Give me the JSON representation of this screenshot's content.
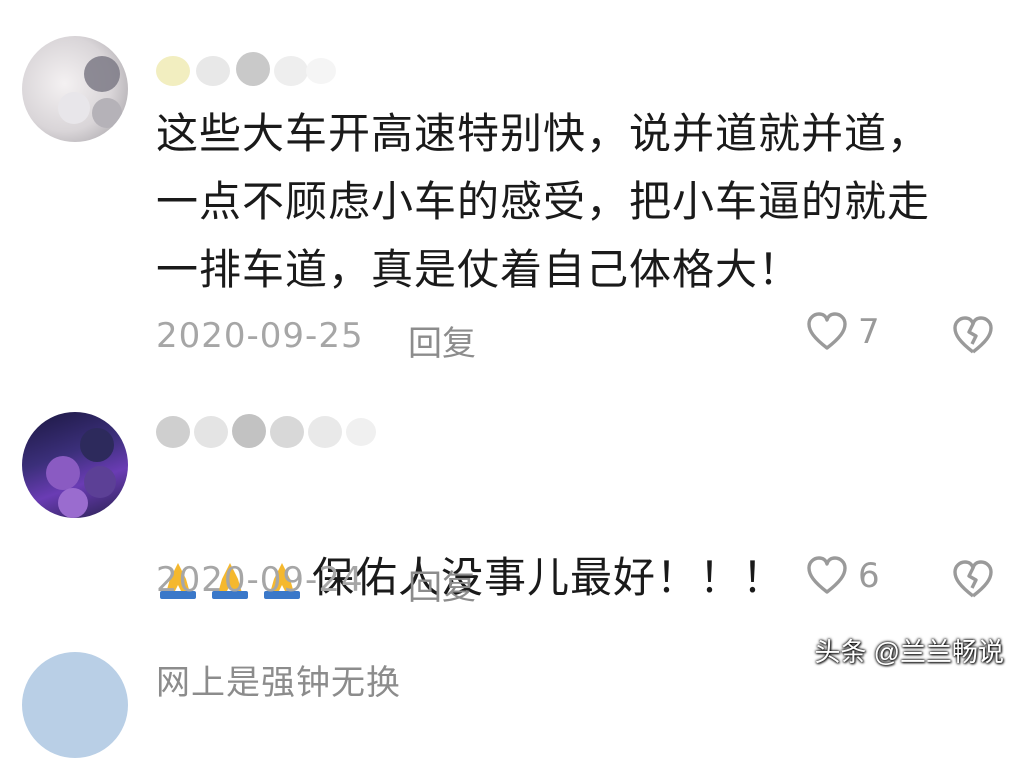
{
  "comments": [
    {
      "text": "这些大车开高速特别快，说并道就并道，\n一点不顾虑小车的感受，把小车逼的就走\n一排车道，真是仗着自己体格大！",
      "date": "2020-09-25",
      "reply_label": "回复",
      "likes": "7"
    },
    {
      "text": "保佑人没事儿最好！！！",
      "date": "2020-09-24",
      "reply_label": "回复",
      "likes": "6",
      "emoji_prefix": [
        "folded-hands",
        "folded-hands",
        "folded-hands"
      ]
    },
    {
      "text_partial": "网上是强钟无换"
    }
  ],
  "watermark": "头条 @兰兰畅说",
  "colors": {
    "text": "#1a1a1a",
    "meta": "#a6a6a6",
    "icon": "#9a9a9a"
  }
}
